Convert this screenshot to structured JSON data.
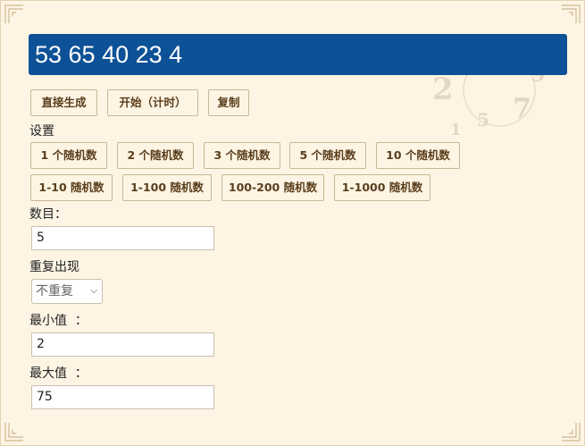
{
  "display": {
    "value": "53 65 40 23 4"
  },
  "actions": {
    "generate": "直接生成",
    "start_timed": "开始（计时）",
    "copy": "复制"
  },
  "settings_label": "设置",
  "presets_count": [
    "1 个随机数",
    "2 个随机数",
    "3 个随机数",
    "5 个随机数",
    "10 个随机数"
  ],
  "presets_range": [
    "1-10 随机数",
    "1-100 随机数",
    "100-200 随机数",
    "1-1000 随机数"
  ],
  "count": {
    "label": "数目：",
    "value": "5"
  },
  "repeat": {
    "label": "重复出现",
    "selected": "不重复"
  },
  "min": {
    "label": "最小值  ：",
    "value": "2"
  },
  "max": {
    "label": "最大值  ：",
    "value": "75"
  },
  "colors": {
    "display_bg": "#0d5196",
    "page_bg": "#fdf4e4",
    "button_text": "#5a3e1b"
  },
  "icons": {
    "corners": "ornament-corner-icon",
    "select_arrow": "chevron-down-icon"
  }
}
